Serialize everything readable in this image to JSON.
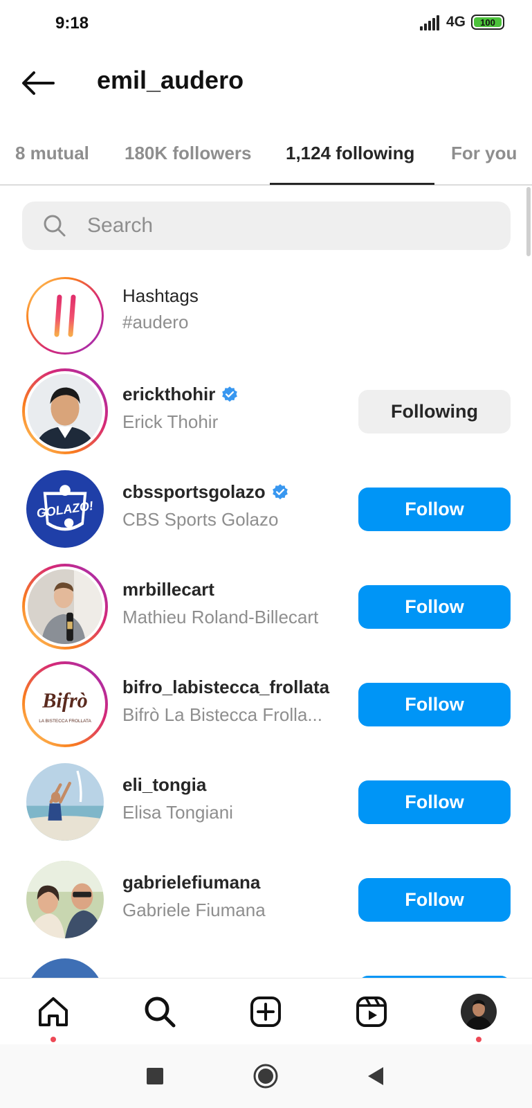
{
  "status_bar": {
    "time": "9:18",
    "network": "4G",
    "battery": "100"
  },
  "header": {
    "title": "emil_audero"
  },
  "tabs": [
    {
      "label": "8 mutual"
    },
    {
      "label": "180K followers"
    },
    {
      "label": "1,124 following",
      "active": true
    },
    {
      "label": "For you"
    }
  ],
  "search": {
    "placeholder": "Search"
  },
  "hashtags": {
    "title": "Hashtags",
    "subtitle": "#audero"
  },
  "users": [
    {
      "username": "erickthohir",
      "fullname": "Erick Thohir",
      "verified": true,
      "button": "Following"
    },
    {
      "username": "cbssportsgolazo",
      "fullname": "CBS Sports Golazo",
      "verified": true,
      "button": "Follow",
      "logo_text": "GOLAZO!"
    },
    {
      "username": "mrbillecart",
      "fullname": "Mathieu Roland-Billecart",
      "verified": false,
      "button": "Follow"
    },
    {
      "username": "bifro_labistecca_frollata",
      "fullname": "Bifrò La Bistecca Frolla...",
      "verified": false,
      "button": "Follow",
      "logo_text": "Bifrò",
      "logo_subtext": "LA BISTECCA FROLLATA"
    },
    {
      "username": "eli_tongia",
      "fullname": "Elisa Tongiani",
      "verified": false,
      "button": "Follow"
    },
    {
      "username": "gabrielefiumana",
      "fullname": "Gabriele Fiumana",
      "verified": false,
      "button": "Follow"
    }
  ],
  "bottom_nav": [
    "home-icon",
    "search-icon",
    "create-icon",
    "reels-icon",
    "profile-avatar"
  ],
  "colors": {
    "accent": "#0095f6",
    "notification": "#ed4956",
    "verified": "#3897f0"
  }
}
